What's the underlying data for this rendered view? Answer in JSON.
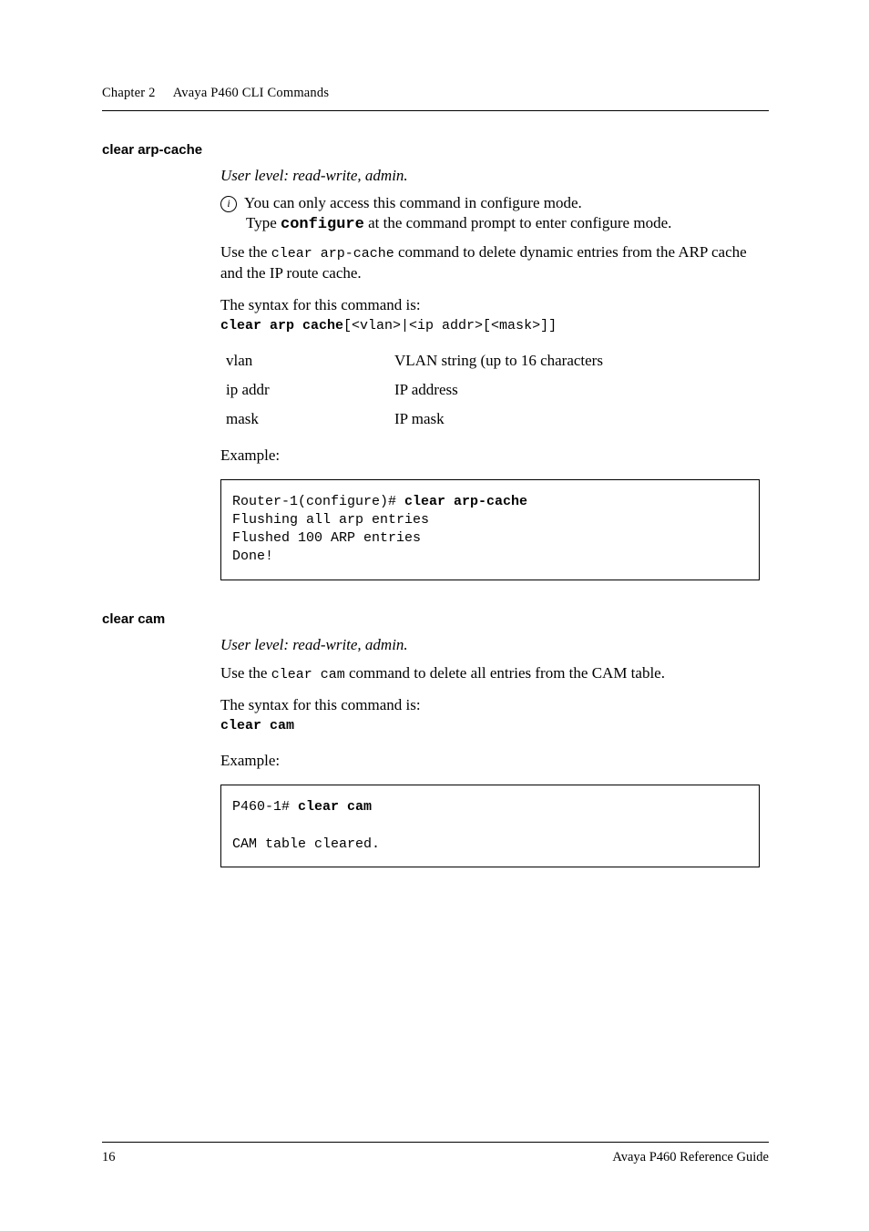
{
  "header": {
    "chapter": "Chapter 2",
    "title": "Avaya P460 CLI Commands"
  },
  "sections": [
    {
      "heading": "clear arp-cache",
      "userlevel": "User level: read-write, admin.",
      "note_line": "You can only access this command in configure mode.",
      "note_sub_pre": "Type ",
      "note_sub_cmd": "configure",
      "note_sub_post": " at the command prompt to enter configure mode.",
      "body_pre": "Use the ",
      "body_mono": "clear arp-cache",
      "body_post": " command to delete dynamic entries from the ARP cache and the IP route cache.",
      "syntax_intro": "The syntax for this command is:",
      "syntax_bold": "clear arp cache",
      "syntax_rest": "[<vlan>|<ip addr>[<mask>]]",
      "params": [
        {
          "name": "vlan",
          "desc": "VLAN string (up to 16 characters"
        },
        {
          "name": "ip addr",
          "desc": "IP address"
        },
        {
          "name": "mask",
          "desc": "IP mask"
        }
      ],
      "example_label": "Example:",
      "code": {
        "line1_pre": "Router-1(configure)# ",
        "line1_cmd": "clear arp-cache",
        "line2": "Flushing all arp entries",
        "line3": "Flushed 100 ARP entries",
        "line4": "Done!"
      }
    },
    {
      "heading": "clear cam",
      "userlevel": "User level: read-write, admin.",
      "body_pre": "Use the ",
      "body_mono": "clear cam",
      "body_post": " command to delete all entries from the CAM table.",
      "syntax_intro": "The syntax for this command is:",
      "syntax_bold": "clear cam",
      "example_label": "Example:",
      "code": {
        "line1_pre": "P460-1# ",
        "line1_cmd": "clear cam",
        "blank": "",
        "line2": "CAM table cleared."
      }
    }
  ],
  "footer": {
    "page": "16",
    "doc": "Avaya P460 Reference Guide"
  }
}
